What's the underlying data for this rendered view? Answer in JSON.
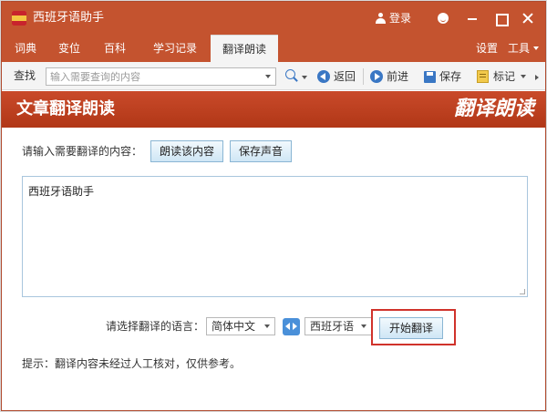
{
  "window": {
    "title": "西班牙语助手",
    "login_label": "登录"
  },
  "menu": {
    "tabs": [
      {
        "label": "词典"
      },
      {
        "label": "变位"
      },
      {
        "label": "百科"
      },
      {
        "label": "学习记录"
      },
      {
        "label": "翻译朗读",
        "active": true
      }
    ],
    "settings_label": "设置",
    "tools_label": "工具"
  },
  "toolbar": {
    "search_label": "查找",
    "search_placeholder": "输入需要查询的内容",
    "back_label": "返回",
    "forward_label": "前进",
    "save_label": "保存",
    "bookmark_label": "标记"
  },
  "banner": {
    "title": "文章翻译朗读",
    "logo_text": "翻译朗读"
  },
  "content": {
    "prompt_label": "请输入需要翻译的内容：",
    "read_button": "朗读该内容",
    "save_audio_button": "保存声音",
    "input_text": "西班牙语助手",
    "lang_label": "请选择翻译的语言：",
    "source_lang": "简体中文",
    "target_lang": "西班牙语",
    "translate_button": "开始翻译",
    "hint": "提示：翻译内容未经过人工核对，仅供参考。"
  },
  "colors": {
    "brand": "#c4532f",
    "banner": "#b13717",
    "accent_blue": "#3a77c4",
    "highlight": "#d0322b"
  }
}
